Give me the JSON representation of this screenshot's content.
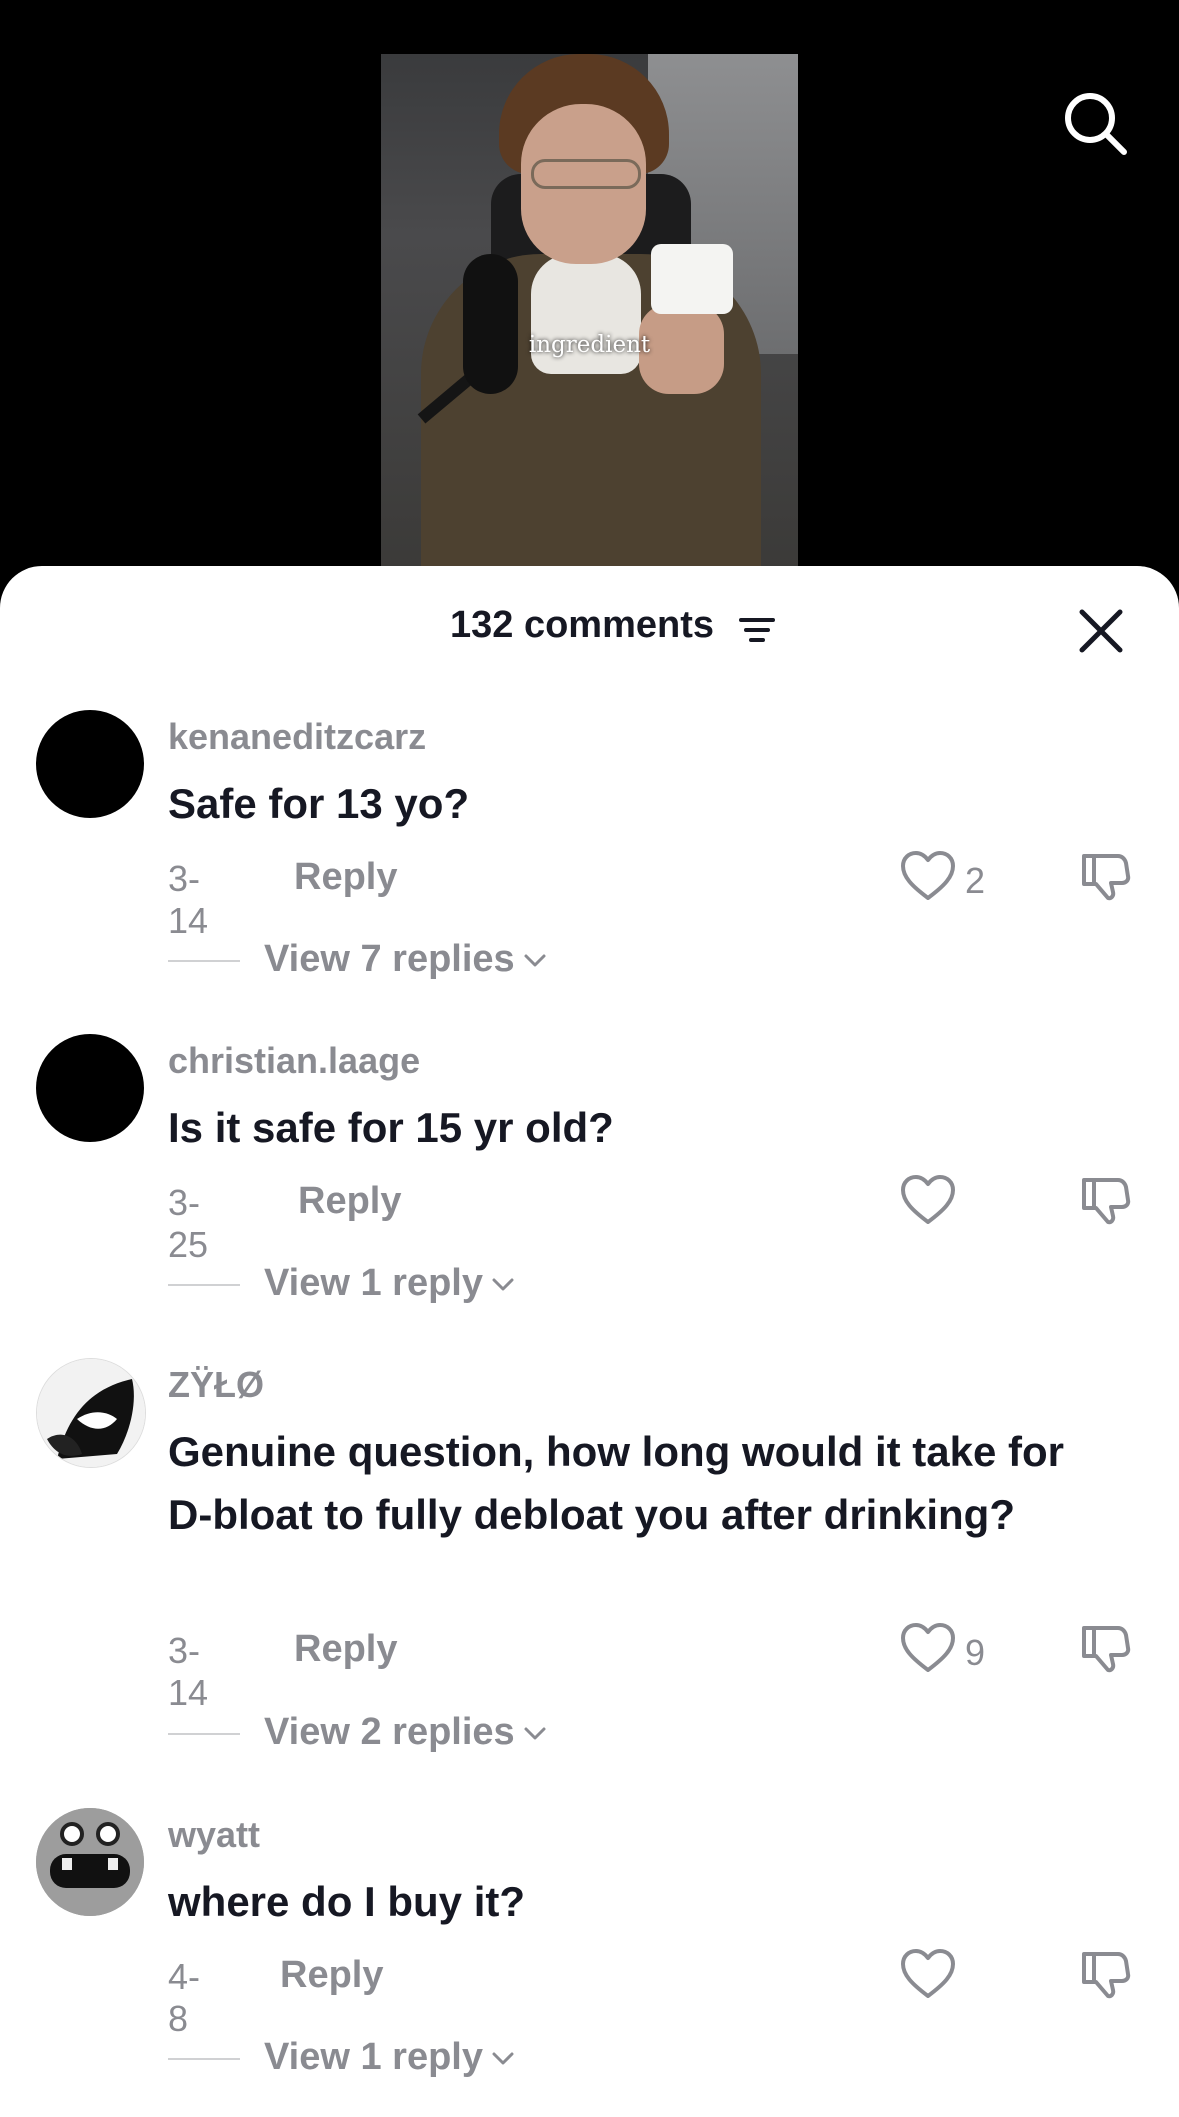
{
  "video": {
    "caption": "ingredient"
  },
  "header": {
    "comment_count": "132 comments"
  },
  "icons": {
    "search": "search-icon",
    "filter": "filter-icon",
    "close": "close-icon",
    "like": "heart-icon",
    "dislike": "thumbs-down-icon",
    "expand": "chevron-down-icon"
  },
  "colors": {
    "primary_text": "#161823",
    "secondary_text": "#8a8b91",
    "sheet_background": "#ffffff",
    "page_background": "#000000"
  },
  "comments": [
    {
      "username": "kenaneditzcarz",
      "text": "Safe for 13 yo?",
      "date": "3-14",
      "reply_label": "Reply",
      "likes": "2",
      "view_replies": "View 7 replies"
    },
    {
      "username": "christian.laage",
      "text": "Is it safe for 15 yr old?",
      "date": "3-25",
      "reply_label": "Reply",
      "likes": "",
      "view_replies": "View 1 reply"
    },
    {
      "username": "ZŸŁØ",
      "text": "Genuine question, how long would it take for D-bloat to fully debloat you after drinking?",
      "date": "3-14",
      "reply_label": "Reply",
      "likes": "9",
      "view_replies": "View 2 replies"
    },
    {
      "username": "wyatt",
      "text": "where do I buy it?",
      "date": "4-8",
      "reply_label": "Reply",
      "likes": "",
      "view_replies": "View 1 reply"
    }
  ]
}
